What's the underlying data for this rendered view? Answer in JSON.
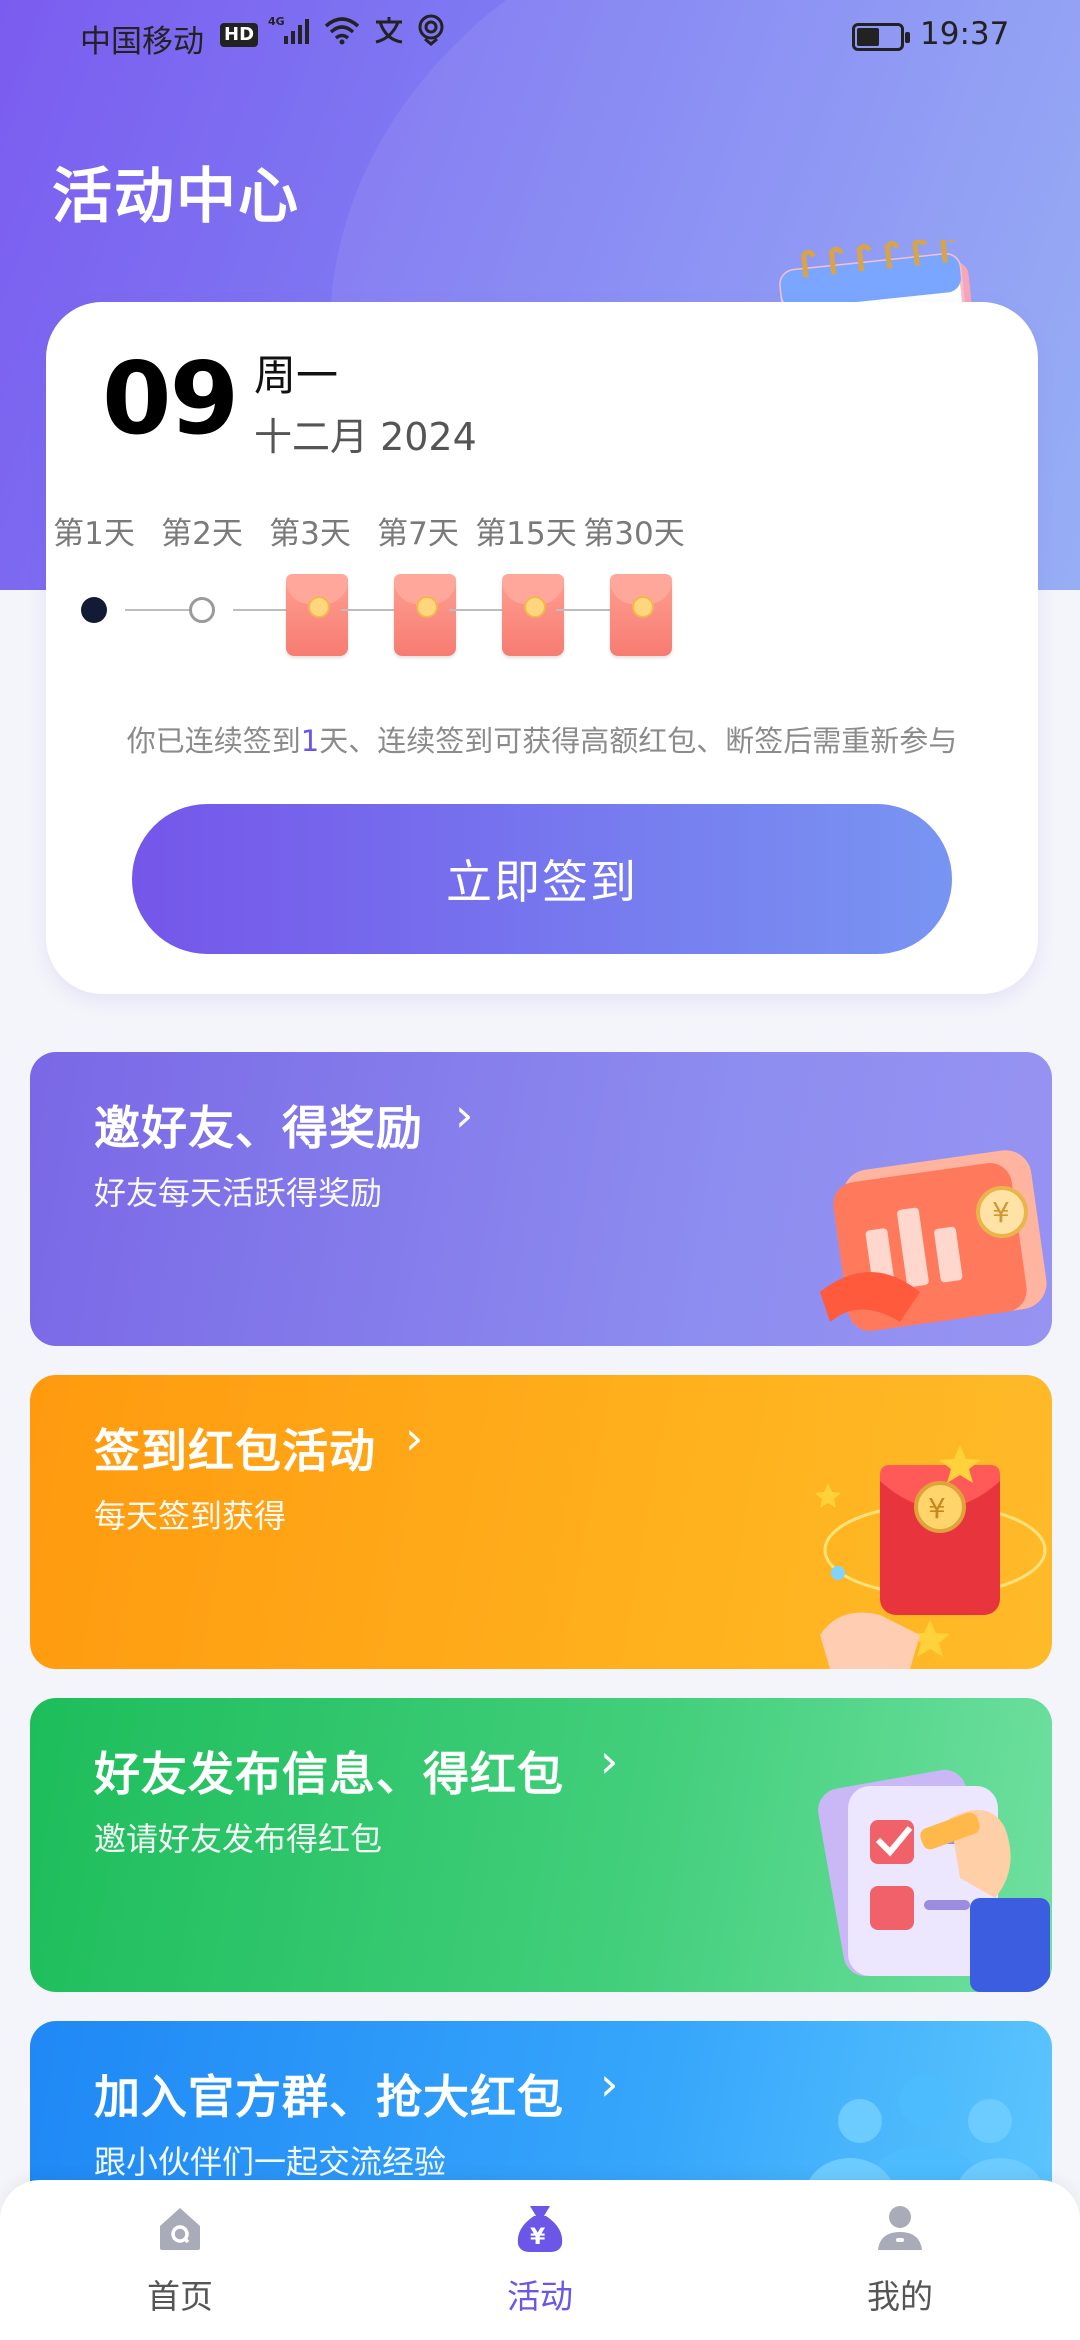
{
  "status_bar": {
    "carrier": "中国移动",
    "network_badges": [
      "HD",
      "4G"
    ],
    "icons": [
      "signal-icon",
      "wifi-icon",
      "translate-icon",
      "location-icon"
    ],
    "battery_level": 0.5,
    "time": "19:37"
  },
  "header": {
    "title": "活动中心"
  },
  "signin_card": {
    "day": "09",
    "weekday": "周一",
    "month_year": "十二月 2024",
    "steps": [
      {
        "label": "第1天",
        "state": "checked"
      },
      {
        "label": "第2天",
        "state": "unchecked"
      },
      {
        "label": "第3天",
        "state": "red-envelope"
      },
      {
        "label": "第7天",
        "state": "red-envelope"
      },
      {
        "label": "第15天",
        "state": "red-envelope"
      },
      {
        "label": "第30天",
        "state": "red-envelope"
      }
    ],
    "streak_prefix": "你已连续签到",
    "streak_days": "1",
    "streak_suffix": "天、连续签到可获得高额红包、断签后需重新参与",
    "button_label": "立即签到"
  },
  "promos": [
    {
      "title": "邀好友、得奖励",
      "subtitle": "好友每天活跃得奖励",
      "icon": "calendar-chart-icon",
      "color": "#7a68e6"
    },
    {
      "title": "签到红包活动",
      "subtitle": "每天签到获得",
      "icon": "red-envelope-icon",
      "color": "#ff9a0f"
    },
    {
      "title": "好友发布信息、得红包",
      "subtitle": "邀请好友发布得红包",
      "icon": "checklist-hand-icon",
      "color": "#1dbd5b"
    },
    {
      "title": "加入官方群、抢大红包",
      "subtitle": "跟小伙伴们一起交流经验",
      "icon": "group-people-icon",
      "color": "#1f88f5"
    }
  ],
  "bottom_nav": {
    "items": [
      {
        "label": "首页",
        "icon": "home-icon"
      },
      {
        "label": "活动",
        "icon": "money-bag-icon",
        "active": true
      },
      {
        "label": "我的",
        "icon": "profile-icon"
      }
    ],
    "active_color": "#6b56e8"
  }
}
